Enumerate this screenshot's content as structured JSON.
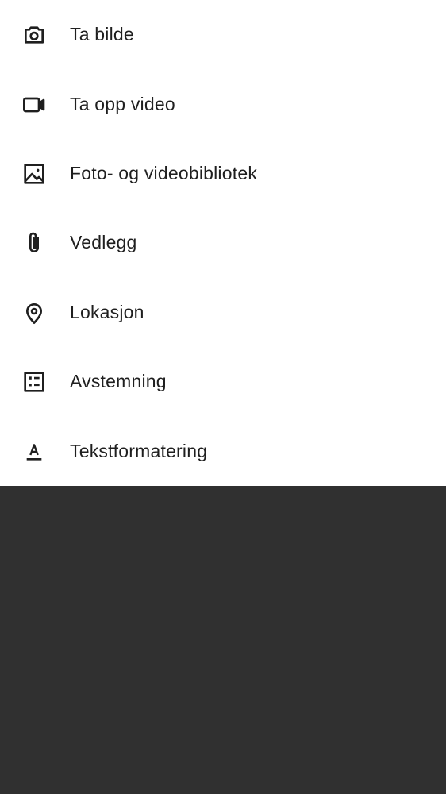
{
  "attachment_menu": {
    "items": [
      {
        "label": "Ta bilde",
        "icon": "camera-icon"
      },
      {
        "label": "Ta opp video",
        "icon": "videocam-icon"
      },
      {
        "label": "Foto- og videobibliotek",
        "icon": "image-icon"
      },
      {
        "label": "Vedlegg",
        "icon": "paperclip-icon"
      },
      {
        "label": "Lokasjon",
        "icon": "location-pin-icon"
      },
      {
        "label": "Avstemning",
        "icon": "poll-checklist-icon"
      },
      {
        "label": "Tekstformatering",
        "icon": "text-format-icon"
      }
    ]
  },
  "colors": {
    "sheet_background": "#ffffff",
    "scrim_background": "#303030",
    "text": "#1f1f1f",
    "icon": "#1f1f1f"
  }
}
